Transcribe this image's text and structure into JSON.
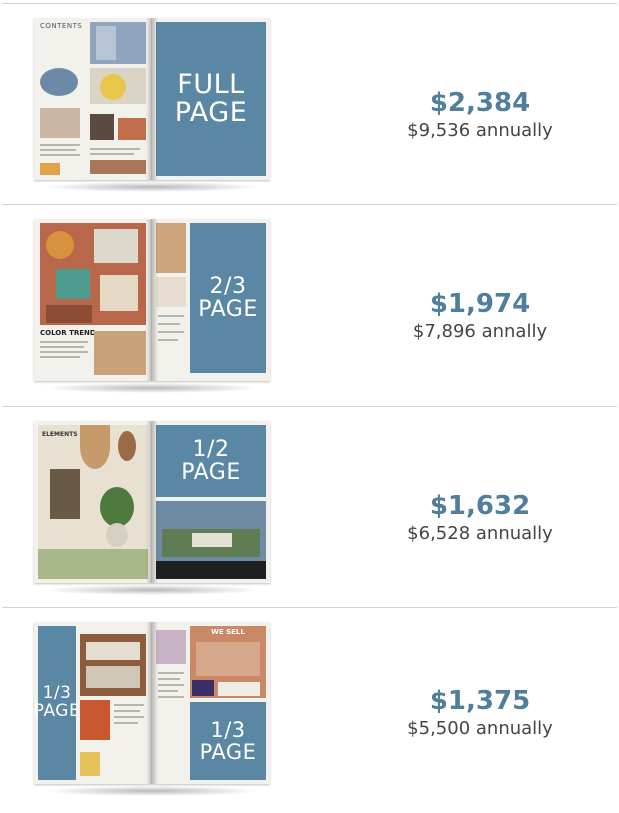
{
  "ad_options": [
    {
      "ad_size": "FULL PAGE",
      "ad_label_lines": [
        "FULL",
        "PAGE"
      ],
      "price": "$2,384",
      "annual": "$9,536 annually",
      "left_page_heading": "CONTENTS"
    },
    {
      "ad_size": "2/3 PAGE",
      "ad_label_lines": [
        "2/3",
        "PAGE"
      ],
      "price": "$1,974",
      "annual": "$7,896 annally",
      "left_page_heading": "COLOR TREND"
    },
    {
      "ad_size": "1/2 PAGE",
      "ad_label_lines": [
        "1/2",
        "PAGE"
      ],
      "price": "$1,632",
      "annual": "$6,528 annually",
      "left_page_heading": "ELEMENTS"
    },
    {
      "ad_size": "1/3 PAGE",
      "ad_label_lines": [
        "1/3",
        "PAGE"
      ],
      "ad_label_lines_2": [
        "1/3",
        "PAGE"
      ],
      "price": "$1,375",
      "annual": "$5,500 annually",
      "right_page_banner": "WE SELL"
    }
  ]
}
